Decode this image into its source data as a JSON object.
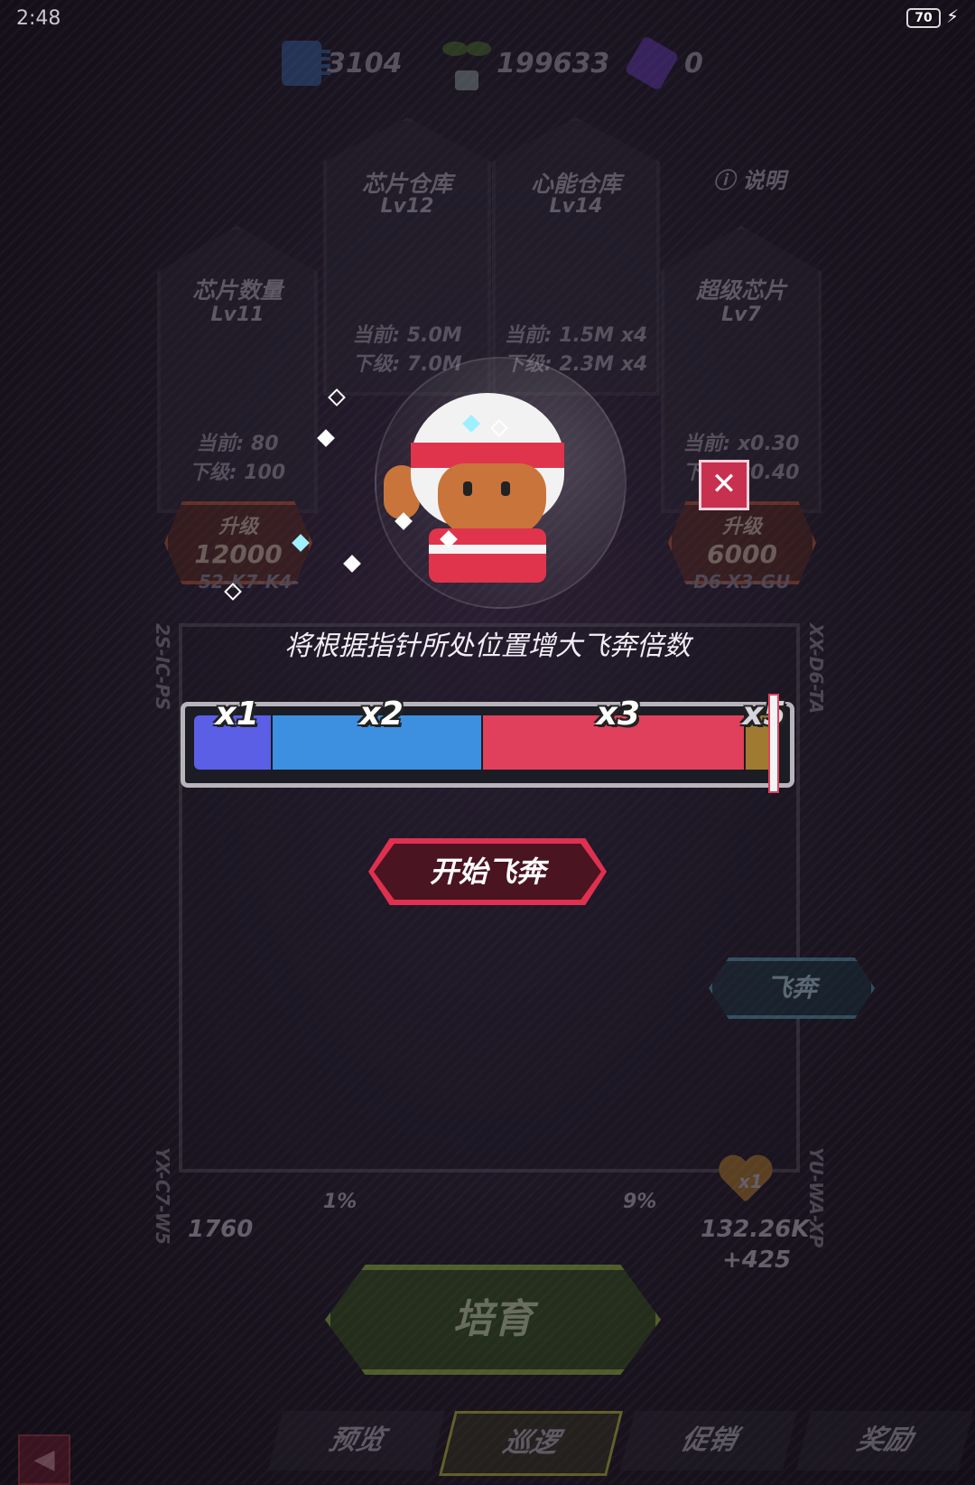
{
  "status_bar": {
    "time": "2:48",
    "battery": "70"
  },
  "resources": {
    "chips": "3104",
    "sprouts": "199633",
    "cubes": "0"
  },
  "help_label": "说明",
  "cards": [
    {
      "title": "芯片数量",
      "level": "Lv11",
      "current": "当前: 80",
      "next": "下级: 100",
      "upgrade_label": "升级",
      "cost": "12000",
      "code": "52-K7-K4-"
    },
    {
      "title": "芯片仓库",
      "level": "Lv12",
      "current": "当前: 5.0M",
      "next": "下级: 7.0M"
    },
    {
      "title": "心能仓库",
      "level": "Lv14",
      "current": "当前: 1.5M x4",
      "next": "下级: 2.3M x4"
    },
    {
      "title": "超级芯片",
      "level": "Lv7",
      "current": "当前: x0.30",
      "next": "下级: x0.40",
      "upgrade_label": "升级",
      "cost": "6000",
      "code": "-D6-X3-GU"
    }
  ],
  "field": {
    "side_codes": [
      "2S-IC-PS",
      "XX-D6-TA",
      "YX-C7-W5",
      "YU-WA-XP"
    ],
    "fly_button": "飞奔",
    "left_pct": "1%",
    "right_pct": "9%",
    "left_count": "1760",
    "heart_mult": "x1",
    "heart_value": "132.26K",
    "heart_gain": "+425"
  },
  "cultivate_label": "培育",
  "nav": {
    "tabs": [
      "预览",
      "巡逻",
      "促销",
      "奖励"
    ],
    "active": 1
  },
  "dialog": {
    "hint": "将根据指针所处位置增大飞奔倍数",
    "multipliers": [
      {
        "label": "x1",
        "color": "#5b5fe6",
        "start": 0.0,
        "end": 0.136
      },
      {
        "label": "x2",
        "color": "#3d8fe0",
        "start": 0.136,
        "end": 0.5
      },
      {
        "label": "x3",
        "color": "#e0405c",
        "start": 0.5,
        "end": 0.955
      },
      {
        "label": "x5",
        "color": "#a07a30",
        "start": 0.955,
        "end": 1.0
      }
    ],
    "pointer_position": 1.0,
    "start_button": "开始飞奔",
    "close_icon": "close-icon"
  }
}
